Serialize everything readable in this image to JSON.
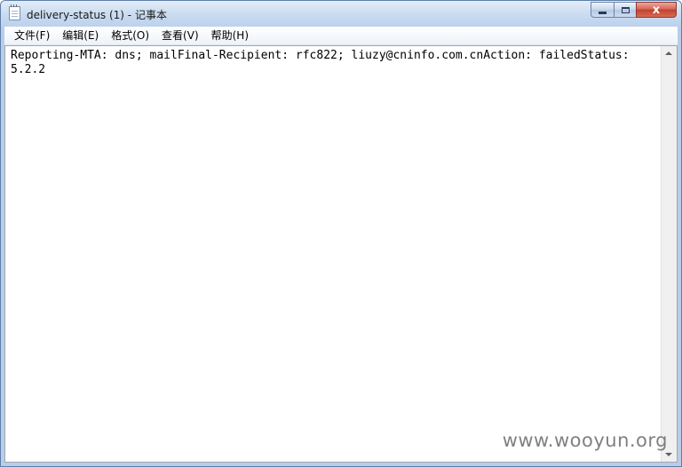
{
  "window": {
    "title": "delivery-status (1) - 记事本",
    "app_icon": "notepad-icon"
  },
  "caption_buttons": {
    "minimize": "minimize-icon",
    "maximize": "maximize-icon",
    "close": "close-icon",
    "close_glyph": "x"
  },
  "menu": {
    "items": [
      {
        "label": "文件(F)"
      },
      {
        "label": "编辑(E)"
      },
      {
        "label": "格式(O)"
      },
      {
        "label": "查看(V)"
      },
      {
        "label": "帮助(H)"
      }
    ]
  },
  "editor": {
    "content": "Reporting-MTA: dns; mailFinal-Recipient: rfc822; liuzy@cninfo.com.cnAction: failedStatus:\n5.2.2"
  },
  "watermark": {
    "text": "www.wooyun.org"
  },
  "colors": {
    "titlebar": "#c9dbf0",
    "close_button": "#c2402f",
    "editor_background": "#ffffff"
  }
}
